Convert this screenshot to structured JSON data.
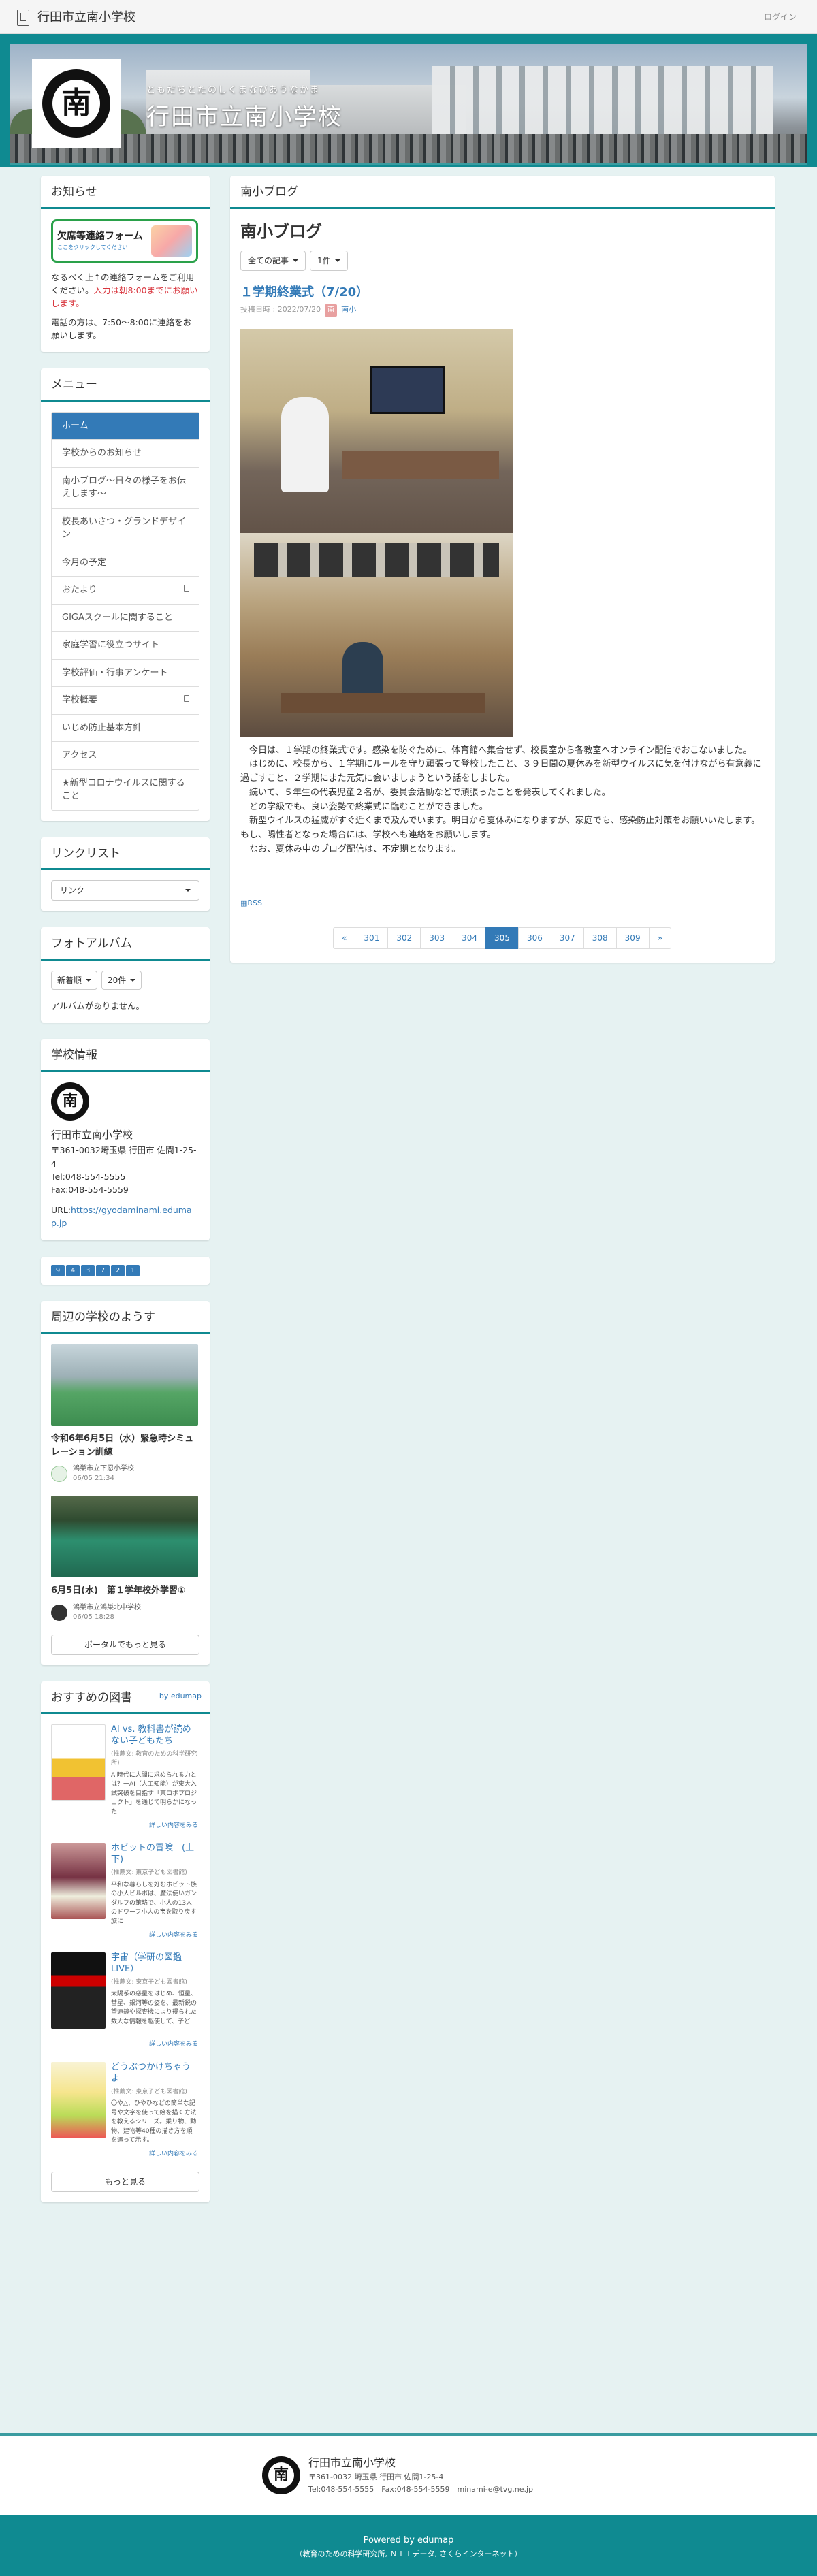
{
  "navbar": {
    "site_name": "行田市立南小学校",
    "login": "ログイン"
  },
  "header": {
    "subtitle": "ともだちとたのしくまなびあうなかま",
    "title": "行田市立南小学校",
    "emblem_char": "南"
  },
  "notice": {
    "heading": "お知らせ",
    "banner_title": "欠席等連絡フォーム",
    "banner_sub": "ここをクリックしてください",
    "text_before": "なるべく上↑の連絡フォームをご利用ください。",
    "text_red": "入力は朝8:00までにお願いします。",
    "text_phone": "電話の方は、7:50〜8:00に連絡をお願いします。"
  },
  "menu": {
    "heading": "メニュー",
    "items": [
      {
        "label": "ホーム"
      },
      {
        "label": "学校からのお知らせ"
      },
      {
        "label": "南小ブログ〜日々の様子をお伝えします〜"
      },
      {
        "label": "校長あいさつ・グランドデザイン"
      },
      {
        "label": "今月の予定"
      },
      {
        "label": "おたより"
      },
      {
        "label": "GIGAスクールに関すること"
      },
      {
        "label": "家庭学習に役立つサイト"
      },
      {
        "label": "学校評価・行事アンケート"
      },
      {
        "label": "学校概要"
      },
      {
        "label": "いじめ防止基本方針"
      },
      {
        "label": "アクセス"
      },
      {
        "label": "★新型コロナウイルスに関すること"
      }
    ]
  },
  "links": {
    "heading": "リンクリスト",
    "select": "リンク"
  },
  "album": {
    "heading": "フォトアルバム",
    "sort": "新着順",
    "count": "20件",
    "empty": "アルバムがありません。"
  },
  "school_info": {
    "heading": "学校情報",
    "name": "行田市立南小学校",
    "address": "〒361-0032埼玉県 行田市 佐間1-25-4",
    "tel": "Tel:048-554-5555",
    "fax": "Fax:048-554-5559",
    "url_label": "URL:",
    "url": "https://gyodaminami.edumap.jp"
  },
  "counter": {
    "digits": [
      "9",
      "4",
      "3",
      "7",
      "2",
      "1"
    ]
  },
  "portal": {
    "heading": "周辺の学校のようす",
    "items": [
      {
        "title": "令和6年6月5日（水）緊急時シミュレーション訓練",
        "school": "鴻巣市立下忍小学校",
        "date": "06/05 21:34"
      },
      {
        "title": "6月5日(水)　第１学年校外学習①",
        "school": "鴻巣市立鴻巣北中学校",
        "date": "06/05 18:28"
      }
    ],
    "more": "ポータルでもっと見る"
  },
  "books": {
    "heading": "おすすめの図書",
    "by": "by edumap",
    "items": [
      {
        "title": "AI vs. 教科書が読めない子どもたち",
        "by": "(推薦文: 教育のための科学研究所)",
        "desc": "AI時代に人間に求められる力とは？一AI（人工知能）が東大入試突破を目指す「東ロボプロジェクト」を通じて明らかになった",
        "more": "詳しい内容をみる"
      },
      {
        "title": "ホビットの冒険　(上下)",
        "by": "(推薦文: 東京子ども図書館)",
        "desc": "平和な暮らしを好むホビット族の小人ビルボは、魔法使いガンダルフの策略で、小人の13人のドワーフ小人の宝を取り戻す旅に",
        "more": "詳しい内容をみる"
      },
      {
        "title": "宇宙（学研の図鑑LIVE）",
        "by": "(推薦文: 東京子ども図書館)",
        "desc": "太陽系の惑星をはじめ、恒星、彗星、銀河等の姿を、最新鋭の望遠鏡や探査機により得られた数大な情報を駆使して、子ど",
        "more": "詳しい内容をみる"
      },
      {
        "title": "どうぶつかけちゃうよ",
        "by": "(推薦文: 東京子ども図書館)",
        "desc": "〇や△、ひやひなどの簡単な記号や文字を使って絵を描く方法を教えるシリーズ。乗り物、動物、建物等40種の描き方を順を追って示す。",
        "more": "詳しい内容をみる"
      }
    ],
    "more": "もっと見る"
  },
  "blog": {
    "panel_heading": "南小ブログ",
    "title": "南小ブログ",
    "filter_all": "全ての記事",
    "filter_count": "1件",
    "entry_title": "１学期終業式（7/20）",
    "posted_label": "投稿日時 : 2022/07/20",
    "author": "南小",
    "author_badge": "南",
    "paragraphs": [
      "今日は、１学期の終業式です。感染を防ぐために、体育館へ集合せず、校長室から各教室へオンライン配信でおこないました。",
      "はじめに、校長から、１学期にルールを守り頑張って登校したこと、３９日間の夏休みを新型ウイルスに気を付けながら有意義に過ごすこと、２学期にまた元気に会いましょうという話をしました。",
      "続いて、５年生の代表児童２名が、委員会活動などで頑張ったことを発表してくれました。",
      "どの学級でも、良い姿勢で終業式に臨むことができました。",
      "新型ウイルスの猛威がすぐ近くまで及んでいます。明日から夏休みになりますが、家庭でも、感染防止対策をお願いいたします。もし、陽性者となった場合には、学校へも連絡をお願いします。",
      "なお、夏休み中のブログ配信は、不定期となります。"
    ],
    "rss": "RSS",
    "pages": [
      "«",
      "301",
      "302",
      "303",
      "304",
      "305",
      "306",
      "307",
      "308",
      "309",
      "»"
    ],
    "active_page": "305"
  },
  "footer": {
    "name": "行田市立南小学校",
    "address": "〒361-0032 埼玉県 行田市 佐間1-25-4",
    "contact": "Tel:048-554-5555　Fax:048-554-5559　minami-e@tvg.ne.jp",
    "powered": "Powered by edumap",
    "powered_sub": "（教育のための科学研究所, ＮＴＴデータ, さくらインターネット）"
  },
  "colors": {
    "accent": "#0f8a91",
    "link": "#337ab7",
    "alert": "#d9363e"
  }
}
